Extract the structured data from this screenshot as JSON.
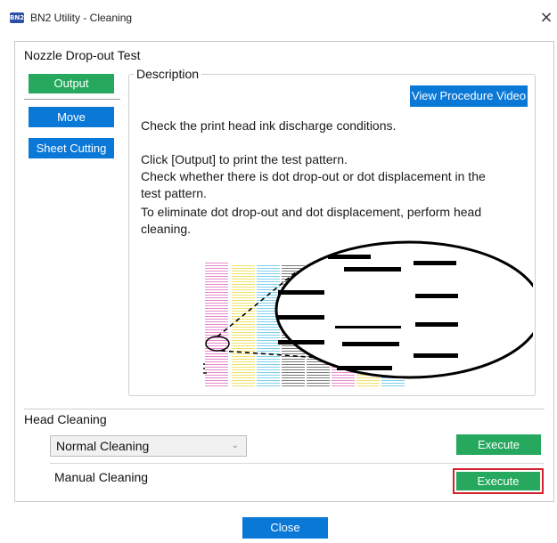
{
  "window": {
    "app_icon_text": "BN2",
    "title": "BN2 Utility - Cleaning",
    "close_glyph": "×"
  },
  "nozzle_section": {
    "title": "Nozzle Drop-out Test",
    "output_label": "Output",
    "move_label": "Move",
    "sheet_cutting_label": "Sheet Cutting"
  },
  "description": {
    "legend": "Description",
    "view_video_label": "View Procedure Video",
    "line1": "Check the print head ink discharge conditions.",
    "line2": "Click [Output] to print the test pattern.",
    "line3": "Check whether there is dot drop-out or dot displacement in the",
    "line4": "test pattern.",
    "line5": "To eliminate dot drop-out and dot displacement, perform head",
    "line6": "cleaning."
  },
  "head_cleaning": {
    "title": "Head Cleaning",
    "select_value": "Normal Cleaning",
    "execute_label_1": "Execute",
    "manual_label": "Manual Cleaning",
    "execute_label_2": "Execute"
  },
  "footer": {
    "close_label": "Close"
  },
  "colors": {
    "blue_button": "#0a78d7",
    "green_button": "#26a95e",
    "highlight": "#d4212b"
  }
}
